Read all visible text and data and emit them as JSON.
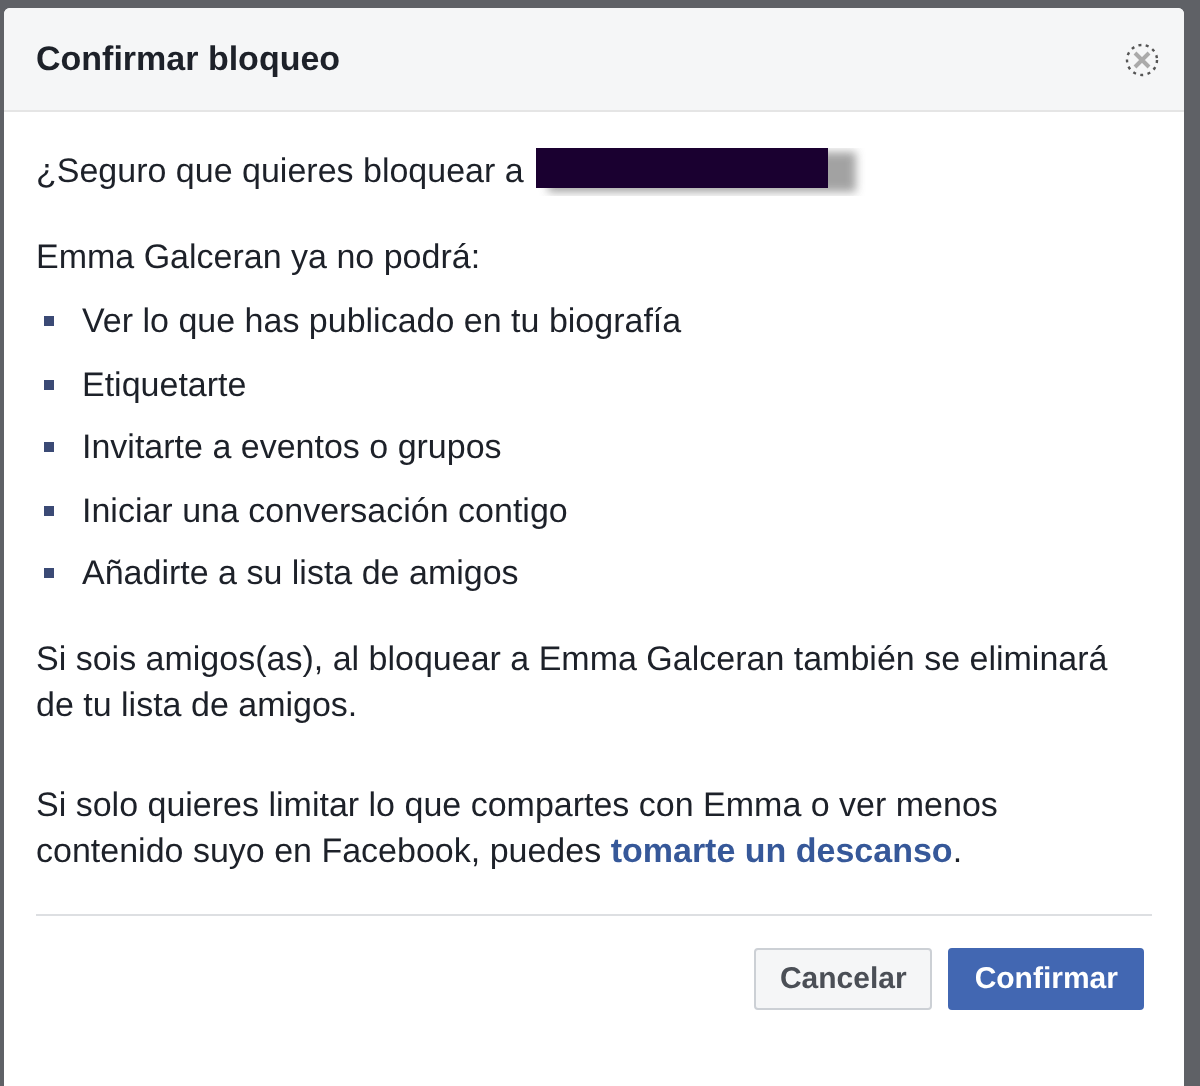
{
  "dialog": {
    "title": "Confirmar bloqueo",
    "question": "¿Seguro que quieres bloquear a",
    "intro": "Emma Galceran ya no podrá:",
    "restrictions": [
      "Ver lo que has publicado en tu biografía",
      "Etiquetarte",
      "Invitarte a eventos o grupos",
      "Iniciar una conversación contigo",
      "Añadirte a su lista de amigos"
    ],
    "note": "Si sois amigos(as), al bloquear a Emma Galceran también se eliminará de tu lista de amigos.",
    "alternative": {
      "before": "Si solo quieres limitar lo que compartes con Emma o ver menos contenido suyo en Facebook, puedes ",
      "link": "tomarte un descanso",
      "after": "."
    },
    "buttons": [
      {
        "label": "Cancelar",
        "kind": "secondary"
      },
      {
        "label": "Confirmar",
        "kind": "primary"
      }
    ]
  }
}
